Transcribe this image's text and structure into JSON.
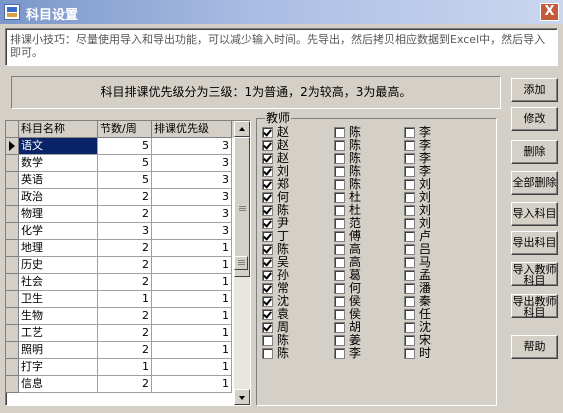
{
  "window": {
    "title": "科目设置",
    "close_glyph": "X"
  },
  "tip": "排课小技巧：尽量使用导入和导出功能，可以减少输入时间。先导出，然后拷贝相应数据到Excel中，然后导入即可。",
  "priority_note": "科目排课优先级分为三级：1为普通，2为较高，3为最高。",
  "grid": {
    "headers": {
      "name": "科目名称",
      "periods": "节数/周",
      "priority": "排课优先级"
    },
    "rows": [
      {
        "name": "语文",
        "periods": "5",
        "priority": "3"
      },
      {
        "name": "数学",
        "periods": "5",
        "priority": "3"
      },
      {
        "name": "英语",
        "periods": "5",
        "priority": "3"
      },
      {
        "name": "政治",
        "periods": "2",
        "priority": "3"
      },
      {
        "name": "物理",
        "periods": "2",
        "priority": "3"
      },
      {
        "name": "化学",
        "periods": "3",
        "priority": "3"
      },
      {
        "name": "地理",
        "periods": "2",
        "priority": "1"
      },
      {
        "name": "历史",
        "periods": "2",
        "priority": "1"
      },
      {
        "name": "社会",
        "periods": "2",
        "priority": "1"
      },
      {
        "name": "卫生",
        "periods": "1",
        "priority": "1"
      },
      {
        "name": "生物",
        "periods": "2",
        "priority": "1"
      },
      {
        "name": "工艺",
        "periods": "2",
        "priority": "1"
      },
      {
        "name": "照明",
        "periods": "2",
        "priority": "1"
      },
      {
        "name": "打字",
        "periods": "1",
        "priority": "1"
      },
      {
        "name": "信息",
        "periods": "2",
        "priority": "1"
      }
    ],
    "selected_row": 0
  },
  "teachers": {
    "label": "教师",
    "col1": [
      {
        "name": "赵",
        "checked": true
      },
      {
        "name": "赵",
        "checked": true
      },
      {
        "name": "赵",
        "checked": true
      },
      {
        "name": "刘",
        "checked": true
      },
      {
        "name": "郑",
        "checked": true
      },
      {
        "name": "何",
        "checked": true
      },
      {
        "name": "陈",
        "checked": true
      },
      {
        "name": "尹",
        "checked": true
      },
      {
        "name": "丁",
        "checked": true
      },
      {
        "name": "陈",
        "checked": true
      },
      {
        "name": "吴",
        "checked": true
      },
      {
        "name": "孙",
        "checked": true
      },
      {
        "name": "常",
        "checked": true
      },
      {
        "name": "沈",
        "checked": true
      },
      {
        "name": "袁",
        "checked": true
      },
      {
        "name": "周",
        "checked": true
      },
      {
        "name": "陈",
        "checked": false
      },
      {
        "name": "陈",
        "checked": false
      }
    ],
    "col2": [
      {
        "name": "陈",
        "checked": false
      },
      {
        "name": "陈",
        "checked": false
      },
      {
        "name": "陈",
        "checked": false
      },
      {
        "name": "陈",
        "checked": false
      },
      {
        "name": "陈",
        "checked": false
      },
      {
        "name": "杜",
        "checked": false
      },
      {
        "name": "杜",
        "checked": false
      },
      {
        "name": "范",
        "checked": false
      },
      {
        "name": "傅",
        "checked": false
      },
      {
        "name": "高",
        "checked": false
      },
      {
        "name": "高",
        "checked": false
      },
      {
        "name": "葛",
        "checked": false
      },
      {
        "name": "何",
        "checked": false
      },
      {
        "name": "侯",
        "checked": false
      },
      {
        "name": "侯",
        "checked": false
      },
      {
        "name": "胡",
        "checked": false
      },
      {
        "name": "姜",
        "checked": false
      },
      {
        "name": "李",
        "checked": false
      }
    ],
    "col3": [
      {
        "name": "李",
        "checked": false
      },
      {
        "name": "李",
        "checked": false
      },
      {
        "name": "李",
        "checked": false
      },
      {
        "name": "李",
        "checked": false
      },
      {
        "name": "刘",
        "checked": false
      },
      {
        "name": "刘",
        "checked": false
      },
      {
        "name": "刘",
        "checked": false
      },
      {
        "name": "刘",
        "checked": false
      },
      {
        "name": "卢",
        "checked": false
      },
      {
        "name": "吕",
        "checked": false
      },
      {
        "name": "马",
        "checked": false
      },
      {
        "name": "孟",
        "checked": false
      },
      {
        "name": "潘",
        "checked": false
      },
      {
        "name": "秦",
        "checked": false
      },
      {
        "name": "任",
        "checked": false
      },
      {
        "name": "沈",
        "checked": false
      },
      {
        "name": "宋",
        "checked": false
      },
      {
        "name": "时",
        "checked": false
      }
    ]
  },
  "buttons": {
    "add": "添加",
    "edit": "修改",
    "delete": "删除",
    "delete_all": "全部删除",
    "import_subjects": "导入科目",
    "export_subjects": "导出科目",
    "import_teachers": "导入教师科目",
    "export_teachers": "导出教师科目",
    "help": "帮助"
  }
}
